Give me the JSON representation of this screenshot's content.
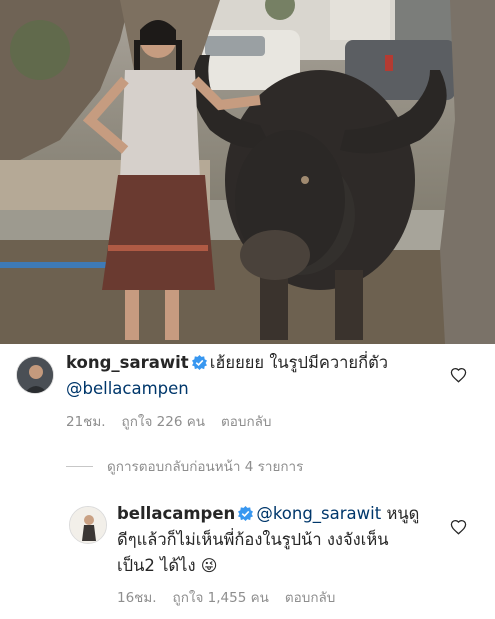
{
  "comments": [
    {
      "username": "kong_sarawit",
      "verified": true,
      "text": "เฮ้ยยยย ในรูปมีควายกี่ตัว",
      "mention": "@bellacampen",
      "time": "21ชม.",
      "likes": "ถูกใจ 226 คน",
      "reply_label": "ตอบกลับ"
    },
    {
      "username": "bellacampen",
      "verified": true,
      "mention": "@kong_sarawit",
      "text_line1": "หนูดู",
      "text_line2": "ดีๆแล้วก็ไม่เห็นพี่ก้องในรูปน้า งงจังเห็น",
      "text_line3": "เป็น2 ได้ไง",
      "emoji": "😜",
      "time": "16ชม.",
      "likes": "ถูกใจ 1,455 คน",
      "reply_label": "ตอบกลับ"
    }
  ],
  "view_replies_label": "ดูการตอบกลับก่อนหน้า 4 รายการ",
  "icons": {
    "verified": "verified-badge-icon",
    "like": "heart-outline-icon"
  },
  "colors": {
    "verified_blue": "#3897f0",
    "mention_blue": "#00376b",
    "secondary_text": "#8e8e8e"
  }
}
